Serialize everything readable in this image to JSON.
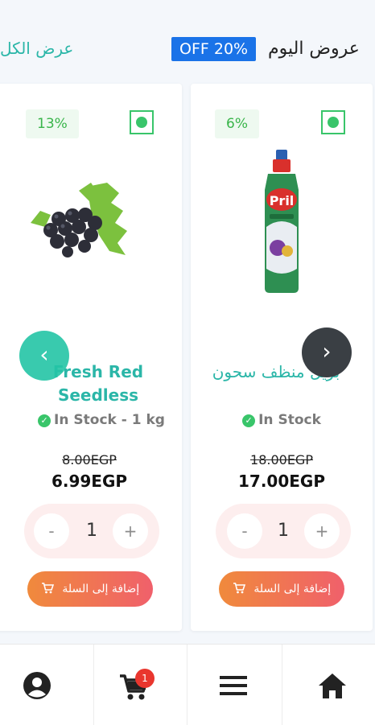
{
  "header": {
    "section_title": "عروض اليوم",
    "offer_badge": "OFF 20%",
    "view_all": "عرض الكل"
  },
  "products": [
    {
      "name": "Fresh Red Seedless",
      "discount": "13%",
      "stock": "In Stock",
      "unit": "- 1 kg",
      "old_price": "8.00EGP",
      "new_price": "6.99EGP",
      "quantity": "1",
      "minus": "-",
      "plus": "+",
      "add_to_cart": "إضافة إلى السلة"
    },
    {
      "name": "بريل منظف سحون",
      "discount": "6%",
      "stock": "In Stock",
      "old_price": "18.00EGP",
      "new_price": "17.00EGP",
      "quantity": "1",
      "minus": "-",
      "plus": "+",
      "add_to_cart": "إضافة إلى السلة"
    }
  ],
  "nav": {
    "cart_count": "1",
    "icons": [
      "account-icon",
      "cart-icon",
      "menu-icon",
      "home-icon"
    ]
  },
  "colors": {
    "accent": "#2bb6a8",
    "offer_badge": "#1a73e8",
    "discount_text": "#39b54a",
    "add_button_start": "#f08a3c",
    "add_button_end": "#f0606b",
    "cart_badge": "#e9362e"
  }
}
